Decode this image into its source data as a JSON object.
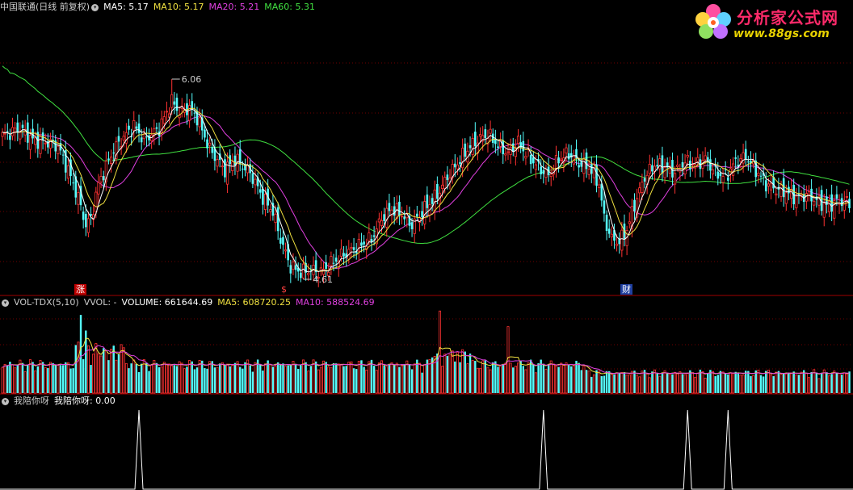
{
  "main_panel": {
    "stock_name": "中国联通",
    "period_info": "(日线 前复权)",
    "ma_labels": [
      {
        "text": "MA5: 5.17",
        "color": "#ffffff"
      },
      {
        "text": "MA10: 5.17",
        "color": "#f0e040"
      },
      {
        "text": "MA20: 5.21",
        "color": "#e040e0"
      },
      {
        "text": "MA60: 5.31",
        "color": "#40e040"
      }
    ],
    "high_label": "6.06",
    "low_label": "4.61",
    "events": [
      {
        "text": "涨",
        "bg": "#c00000"
      },
      {
        "text": "$",
        "bg": "#000000",
        "color": "#ff4040"
      },
      {
        "text": "财",
        "bg": "#2040a0"
      }
    ]
  },
  "volume_panel": {
    "indicator": "VOL-TDX(5,10)",
    "vvol": "VVOL: -",
    "volume": "VOLUME: 661644.69",
    "ma5": "MA5: 608720.25",
    "ma10": "MA10: 588524.69"
  },
  "custom_panel": {
    "name": "我陪你呀",
    "value": "我陪你呀: 0.00"
  },
  "watermark": {
    "title": "分析家公式网",
    "url": "www.88gs.com"
  },
  "colors": {
    "up": "#ff3232",
    "down": "#54fcfc",
    "ma5": "#ffffff",
    "ma10": "#f0e040",
    "ma20": "#e040e0",
    "ma60": "#40e040",
    "vol_ma5": "#f0e040",
    "vol_ma10": "#e040e0",
    "signal": "#ffffff",
    "divider": "#a00000"
  },
  "chart_data": {
    "type": "candlestick",
    "price_range": [
      4.61,
      6.06
    ],
    "signal_peaks": 4
  }
}
